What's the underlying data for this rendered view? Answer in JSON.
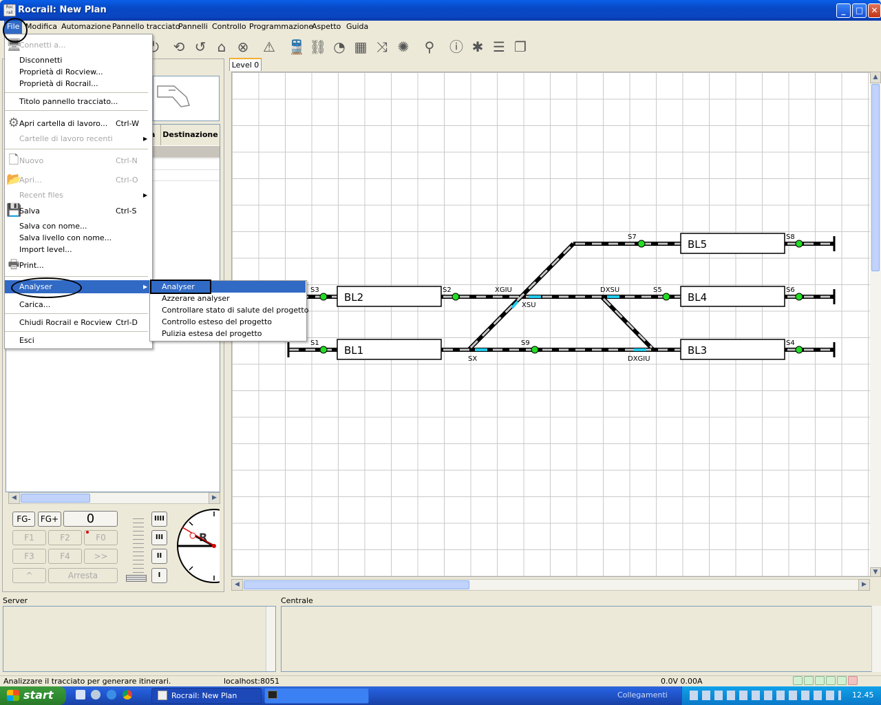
{
  "window": {
    "title": "Rocrail: New Plan"
  },
  "menubar": {
    "items": [
      "File",
      "Modifica",
      "Automazione",
      "Pannello tracciato",
      "Pannelli",
      "Controllo",
      "Programmazione",
      "Aspetto",
      "Guida"
    ]
  },
  "file_menu": {
    "items": [
      {
        "label": "Connetti a...",
        "shortcut": "",
        "enabled": false
      },
      {
        "label": "Disconnetti",
        "shortcut": "",
        "enabled": true
      },
      {
        "label": "Proprietà di Rocview...",
        "shortcut": "",
        "enabled": true
      },
      {
        "label": "Proprietà di Rocrail...",
        "shortcut": "",
        "enabled": true
      },
      {
        "label": "Titolo pannello tracciato...",
        "shortcut": "",
        "enabled": true
      },
      {
        "label": "Apri cartella di lavoro...",
        "shortcut": "Ctrl-W",
        "enabled": true
      },
      {
        "label": "Cartelle di lavoro recenti",
        "shortcut": "",
        "enabled": false
      },
      {
        "label": "Nuovo",
        "shortcut": "Ctrl-N",
        "enabled": false
      },
      {
        "label": "Apri...",
        "shortcut": "Ctrl-O",
        "enabled": false
      },
      {
        "label": "Recent files",
        "shortcut": "",
        "enabled": false
      },
      {
        "label": "Salva",
        "shortcut": "Ctrl-S",
        "enabled": true
      },
      {
        "label": "Salva con nome...",
        "shortcut": "",
        "enabled": true
      },
      {
        "label": "Salva livello con nome...",
        "shortcut": "",
        "enabled": true
      },
      {
        "label": "Import level...",
        "shortcut": "",
        "enabled": true
      },
      {
        "label": "Print...",
        "shortcut": "",
        "enabled": true
      },
      {
        "label": "Analyser",
        "shortcut": "",
        "enabled": true
      },
      {
        "label": "Carica...",
        "shortcut": "",
        "enabled": true
      },
      {
        "label": "Chiudi Rocrail e Rocview",
        "shortcut": "Ctrl-D",
        "enabled": true
      },
      {
        "label": "Esci",
        "shortcut": "",
        "enabled": true
      }
    ]
  },
  "analyser_submenu": {
    "items": [
      "Analyser",
      "Azzerare analyser",
      "Controllare stato di salute del progetto",
      "Controllo esteso del progetto",
      "Pulizia estesa del progetto"
    ]
  },
  "loco_table": {
    "headers": [
      "à",
      "Destinazione"
    ]
  },
  "throttle": {
    "fg_minus": "FG-",
    "fg_plus": "FG+",
    "speed": "0",
    "f1": "F1",
    "f2": "F2",
    "f0": "F0",
    "f3": "F3",
    "f4": "F4",
    "next": ">>",
    "up": "^",
    "stop": "Arresta",
    "gears": [
      "IIII",
      "III",
      "II",
      "I"
    ]
  },
  "plan": {
    "tab": "Level 0",
    "blocks": [
      "BL1",
      "BL2",
      "BL3",
      "BL4",
      "BL5"
    ],
    "signals": [
      "S1",
      "S2",
      "S3",
      "S4",
      "S5",
      "S6",
      "S7",
      "S8",
      "S9"
    ],
    "switches": [
      "XGIU",
      "XSU",
      "DXSU",
      "DXGIU",
      "SX"
    ]
  },
  "panels": {
    "server": "Server",
    "centrale": "Centrale"
  },
  "statusbar": {
    "message": "Analizzare il tracciato per generare itinerari.",
    "host": "localhost:8051",
    "power": "0.0V 0.00A"
  },
  "taskbar": {
    "start": "start",
    "task": "Rocrail: New Plan",
    "links": "Collegamenti",
    "clock": "12.45"
  },
  "colors": {
    "accent": "#316ac5",
    "title_bar": "#0a5fe8",
    "signal_green": "#22dd22",
    "sensor_cyan": "#22ccee"
  }
}
